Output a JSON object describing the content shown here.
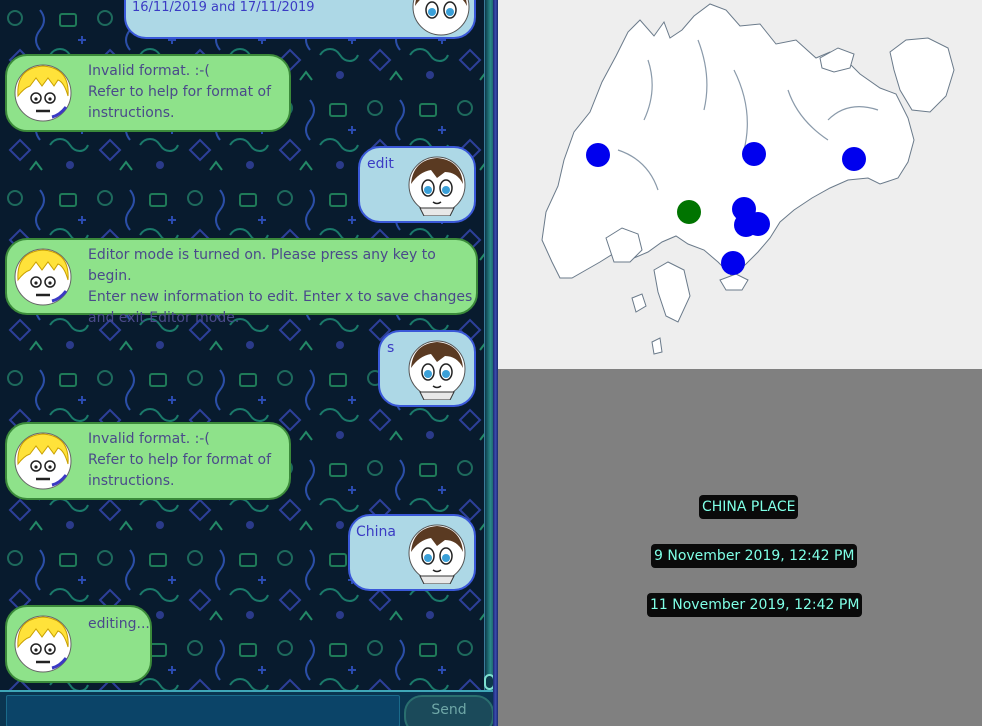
{
  "chat": {
    "messages": [
      {
        "sender": "user",
        "text": "16/11/2019 and 17/11/2019"
      },
      {
        "sender": "bot",
        "text": "Invalid format. :-(\nRefer to help for format of\ninstructions."
      },
      {
        "sender": "user",
        "text": "edit"
      },
      {
        "sender": "bot",
        "text": "Editor mode is turned on. Please press any key to begin.\nEnter new information to edit. Enter x to save changes\nand exit Editor mode."
      },
      {
        "sender": "user",
        "text": "s"
      },
      {
        "sender": "bot",
        "text": "Invalid format. :-(\nRefer to help for format of\ninstructions."
      },
      {
        "sender": "user",
        "text": "China"
      },
      {
        "sender": "bot",
        "text": "editing..."
      }
    ]
  },
  "input": {
    "value": "",
    "placeholder": ""
  },
  "send_button": {
    "label": "Send"
  },
  "map": {
    "markers": [
      {
        "color": "#0000ee"
      },
      {
        "color": "#0000ee"
      },
      {
        "color": "#0000ee"
      },
      {
        "color": "#007400"
      },
      {
        "color": "#0000ee"
      },
      {
        "color": "#0000ee"
      },
      {
        "color": "#0000ee"
      },
      {
        "color": "#0000ee"
      }
    ]
  },
  "details": {
    "place": "CHINA PLACE",
    "start": "9 November 2019, 12:42 PM",
    "end": "11 November 2019, 12:42 PM"
  },
  "colors": {
    "bot_bubble": "#8ee28a",
    "user_bubble": "#add8e6",
    "chat_background": "#081b2e",
    "tag_text": "#7fffe6",
    "map_marker": "#0000ee",
    "map_marker_selected": "#007400"
  }
}
